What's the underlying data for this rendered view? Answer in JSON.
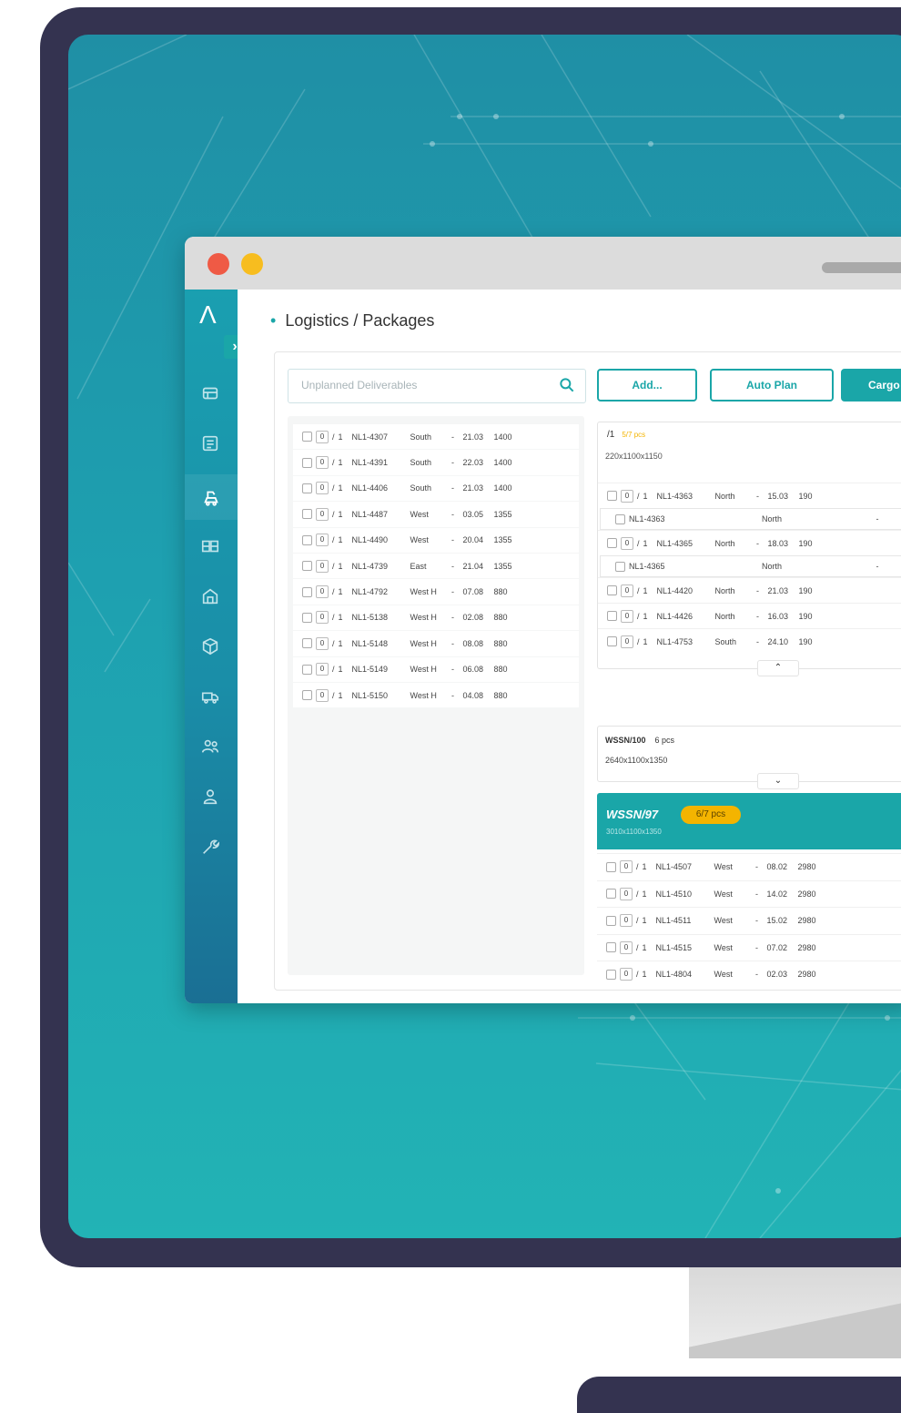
{
  "window": {
    "breadcrumb": "Logistics / Packages",
    "colors": {
      "accent": "#1aa6a8",
      "badge": "#f4b400",
      "close": "#ef5a45",
      "minimize": "#f7bd1f"
    }
  },
  "sidebar": {
    "logo": "Λ",
    "expand": "›",
    "icons": [
      "dashboard-icon",
      "list-icon",
      "cargo-icon",
      "grid-icon",
      "building-icon",
      "package-icon",
      "truck-icon",
      "team-icon",
      "user-icon",
      "tools-icon"
    ]
  },
  "search": {
    "placeholder": "Unplanned Deliverables"
  },
  "toolbar": {
    "add": "Add...",
    "auto_plan": "Auto Plan",
    "cargo": "Cargo"
  },
  "unplanned": [
    {
      "qty": "0",
      "total": "1",
      "code": "NL1-4307",
      "dir": "South",
      "date": "21.03",
      "w": "1400"
    },
    {
      "qty": "0",
      "total": "1",
      "code": "NL1-4391",
      "dir": "South",
      "date": "22.03",
      "w": "1400"
    },
    {
      "qty": "0",
      "total": "1",
      "code": "NL1-4406",
      "dir": "South",
      "date": "21.03",
      "w": "1400"
    },
    {
      "qty": "0",
      "total": "1",
      "code": "NL1-4487",
      "dir": "West",
      "date": "03.05",
      "w": "1355"
    },
    {
      "qty": "0",
      "total": "1",
      "code": "NL1-4490",
      "dir": "West",
      "date": "20.04",
      "w": "1355"
    },
    {
      "qty": "0",
      "total": "1",
      "code": "NL1-4739",
      "dir": "East",
      "date": "21.04",
      "w": "1355"
    },
    {
      "qty": "0",
      "total": "1",
      "code": "NL1-4792",
      "dir": "West H",
      "date": "07.08",
      "w": "880"
    },
    {
      "qty": "0",
      "total": "1",
      "code": "NL1-5138",
      "dir": "West H",
      "date": "02.08",
      "w": "880"
    },
    {
      "qty": "0",
      "total": "1",
      "code": "NL1-5148",
      "dir": "West H",
      "date": "08.08",
      "w": "880"
    },
    {
      "qty": "0",
      "total": "1",
      "code": "NL1-5149",
      "dir": "West H",
      "date": "06.08",
      "w": "880"
    },
    {
      "qty": "0",
      "total": "1",
      "code": "NL1-5150",
      "dir": "West H",
      "date": "04.08",
      "w": "880"
    }
  ],
  "card1": {
    "name": "/1",
    "count": "5/7 pcs",
    "dims": "220x1100x1150",
    "rows": [
      {
        "qty": "0",
        "total": "1",
        "code": "NL1-4363",
        "dir": "North",
        "date": "15.03",
        "w": "190",
        "sub": {
          "code": "NL1-4363",
          "dir": "North"
        }
      },
      {
        "qty": "0",
        "total": "1",
        "code": "NL1-4365",
        "dir": "North",
        "date": "18.03",
        "w": "190",
        "sub": {
          "code": "NL1-4365",
          "dir": "North"
        }
      },
      {
        "qty": "0",
        "total": "1",
        "code": "NL1-4420",
        "dir": "North",
        "date": "21.03",
        "w": "190"
      },
      {
        "qty": "0",
        "total": "1",
        "code": "NL1-4426",
        "dir": "North",
        "date": "16.03",
        "w": "190"
      },
      {
        "qty": "0",
        "total": "1",
        "code": "NL1-4753",
        "dir": "South",
        "date": "24.10",
        "w": "190"
      }
    ],
    "collapse": "⌃"
  },
  "card2": {
    "name": "WSSN/100",
    "count": "6 pcs",
    "dims": "2640x1100x1350",
    "expand": "⌄"
  },
  "card3": {
    "name": "WSSN/97",
    "badge": "6/7 pcs",
    "dims": "3010x1100x1350",
    "rows": [
      {
        "qty": "0",
        "total": "1",
        "code": "NL1-4507",
        "dir": "West",
        "date": "08.02",
        "w": "2980"
      },
      {
        "qty": "0",
        "total": "1",
        "code": "NL1-4510",
        "dir": "West",
        "date": "14.02",
        "w": "2980"
      },
      {
        "qty": "0",
        "total": "1",
        "code": "NL1-4511",
        "dir": "West",
        "date": "15.02",
        "w": "2980"
      },
      {
        "qty": "0",
        "total": "1",
        "code": "NL1-4515",
        "dir": "West",
        "date": "07.02",
        "w": "2980"
      },
      {
        "qty": "0",
        "total": "1",
        "code": "NL1-4804",
        "dir": "West",
        "date": "02.03",
        "w": "2980"
      }
    ]
  }
}
